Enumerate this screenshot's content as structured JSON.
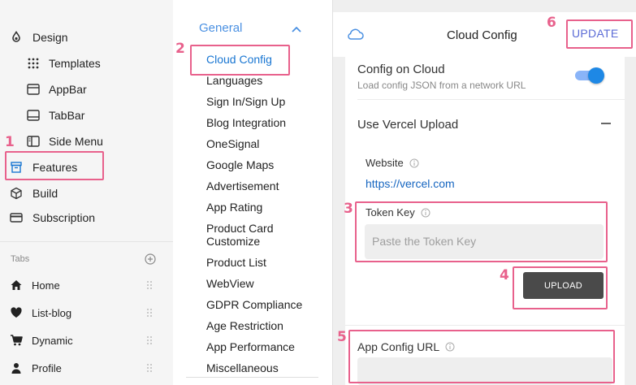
{
  "sidebar": {
    "items": [
      {
        "label": "Design",
        "icon": "palette-icon"
      },
      {
        "label": "Templates",
        "icon": "grid-icon"
      },
      {
        "label": "AppBar",
        "icon": "appbar-icon"
      },
      {
        "label": "TabBar",
        "icon": "tabbar-icon"
      },
      {
        "label": "Side Menu",
        "icon": "side-menu-icon"
      },
      {
        "label": "Features",
        "icon": "archive-icon"
      },
      {
        "label": "Build",
        "icon": "cube-icon"
      },
      {
        "label": "Subscription",
        "icon": "card-icon"
      }
    ],
    "tabs_label": "Tabs",
    "tabs": [
      {
        "label": "Home",
        "icon": "home-icon"
      },
      {
        "label": "List-blog",
        "icon": "heart-icon"
      },
      {
        "label": "Dynamic",
        "icon": "cart-icon"
      },
      {
        "label": "Profile",
        "icon": "person-icon"
      }
    ]
  },
  "menu": {
    "group_title": "General",
    "items": [
      "Cloud Config",
      "Languages",
      "Sign In/Sign Up",
      "Blog Integration",
      "OneSignal",
      "Google Maps",
      "Advertisement",
      "App Rating",
      "Product Card Customize",
      "Product List",
      "WebView",
      "GDPR Compliance",
      "Age Restriction",
      "App Performance",
      "Miscellaneous"
    ],
    "active_item": "Cloud Config"
  },
  "panel": {
    "title": "Cloud Config",
    "update_label": "UPDATE",
    "config_on_cloud": {
      "title": "Config on Cloud",
      "subtitle": "Load config JSON from a network URL",
      "enabled": true
    },
    "vercel": {
      "title": "Use Vercel Upload",
      "website_label": "Website",
      "website_link": "https://vercel.com",
      "token_label": "Token Key",
      "token_placeholder": "Paste the Token Key",
      "upload_label": "UPLOAD"
    },
    "app_config_url_label": "App Config URL",
    "app_config_url_value": ""
  },
  "annotations": [
    "1",
    "2",
    "3",
    "4",
    "5",
    "6"
  ],
  "colors": {
    "accent": "#1976d2",
    "highlight": "#e8618c",
    "toggle": "#1e88e5",
    "upload_button": "#4a4a4a"
  }
}
